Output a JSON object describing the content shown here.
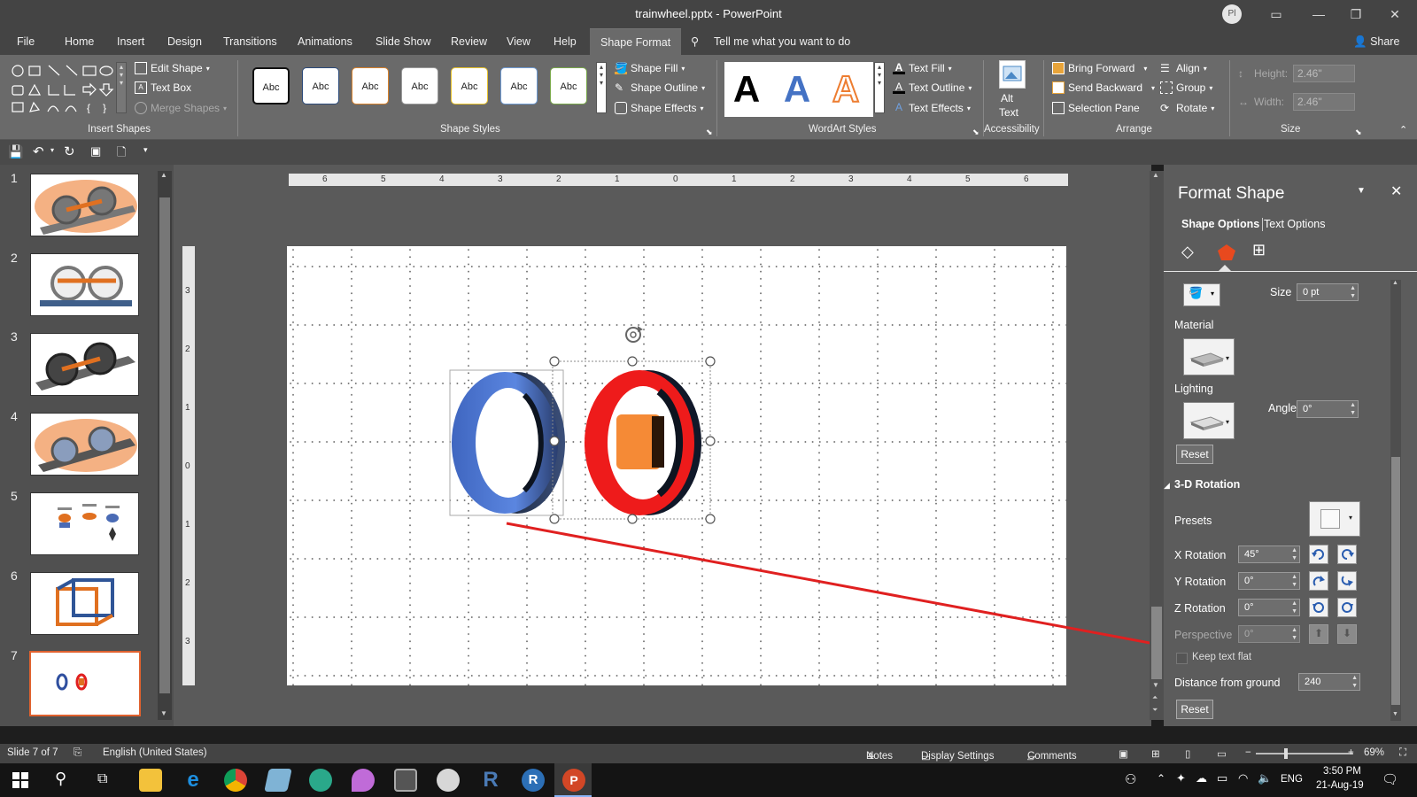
{
  "window": {
    "title": "trainwheel.pptx  -  PowerPoint",
    "avatar": "Pl",
    "share": "Share"
  },
  "tabs": [
    "File",
    "Home",
    "Insert",
    "Design",
    "Transitions",
    "Animations",
    "Slide Show",
    "Review",
    "View",
    "Help",
    "Shape Format"
  ],
  "tell_me": "Tell me what you want to do",
  "ribbon": {
    "insert_shapes": {
      "label": "Insert Shapes",
      "edit_shape": "Edit Shape",
      "text_box": "Text Box",
      "merge_shapes": "Merge Shapes"
    },
    "shape_styles": {
      "label": "Shape Styles",
      "samples": [
        "Abc",
        "Abc",
        "Abc",
        "Abc",
        "Abc",
        "Abc",
        "Abc"
      ],
      "fill": "Shape Fill",
      "outline": "Shape Outline",
      "effects": "Shape Effects"
    },
    "wordart": {
      "label": "WordArt Styles",
      "samples": [
        "A",
        "A",
        "A"
      ],
      "text_fill": "Text Fill",
      "text_outline": "Text Outline",
      "text_effects": "Text Effects"
    },
    "accessibility": {
      "label": "Accessibility",
      "alt_text_1": "Alt",
      "alt_text_2": "Text"
    },
    "arrange": {
      "label": "Arrange",
      "bring_forward": "Bring Forward",
      "send_backward": "Send Backward",
      "selection_pane": "Selection Pane",
      "align": "Align",
      "group": "Group",
      "rotate": "Rotate"
    },
    "size": {
      "label": "Size",
      "height_label": "Height:",
      "height": "2.46\"",
      "width_label": "Width:",
      "width": "2.46\""
    }
  },
  "slides": {
    "numbers": [
      "1",
      "2",
      "3",
      "4",
      "5",
      "6",
      "7"
    ],
    "selected": 7
  },
  "ruler_h": [
    "6",
    "5",
    "4",
    "3",
    "2",
    "1",
    "0",
    "1",
    "2",
    "3",
    "4",
    "5",
    "6"
  ],
  "ruler_v": [
    "3",
    "2",
    "1",
    "0",
    "1",
    "2",
    "3"
  ],
  "pane": {
    "title": "Format Shape",
    "tab_shape": "Shape Options",
    "tab_text": "Text Options",
    "size_label": "Size",
    "size_value": "0 pt",
    "material": "Material",
    "lighting": "Lighting",
    "angle_label": "Angle",
    "angle_value": "0°",
    "reset1": "Reset",
    "section": "3-D Rotation",
    "presets": "Presets",
    "x_rot_label": "X Rotation",
    "x_rot": "45°",
    "y_rot_label": "Y Rotation",
    "y_rot": "0°",
    "z_rot_label": "Z Rotation",
    "z_rot": "0°",
    "perspective_label": "Perspective",
    "perspective": "0°",
    "keep_flat": "Keep text flat",
    "distance_label": "Distance from ground",
    "distance": "240",
    "reset2": "Reset"
  },
  "status": {
    "slide": "Slide 7 of 7",
    "language": "English (United States)",
    "notes": "Notes",
    "display": "Display Settings",
    "comments": "Comments",
    "zoom": "69%"
  },
  "taskbar": {
    "lang": "ENG",
    "time": "3:50 PM",
    "date": "21-Aug-19"
  },
  "colors": {
    "accent": "#c43e1c",
    "annotation": "#e02020",
    "ring_blue": "#4a72c8",
    "ring_red": "#ee1b1b",
    "cube_orange": "#f58a36"
  }
}
